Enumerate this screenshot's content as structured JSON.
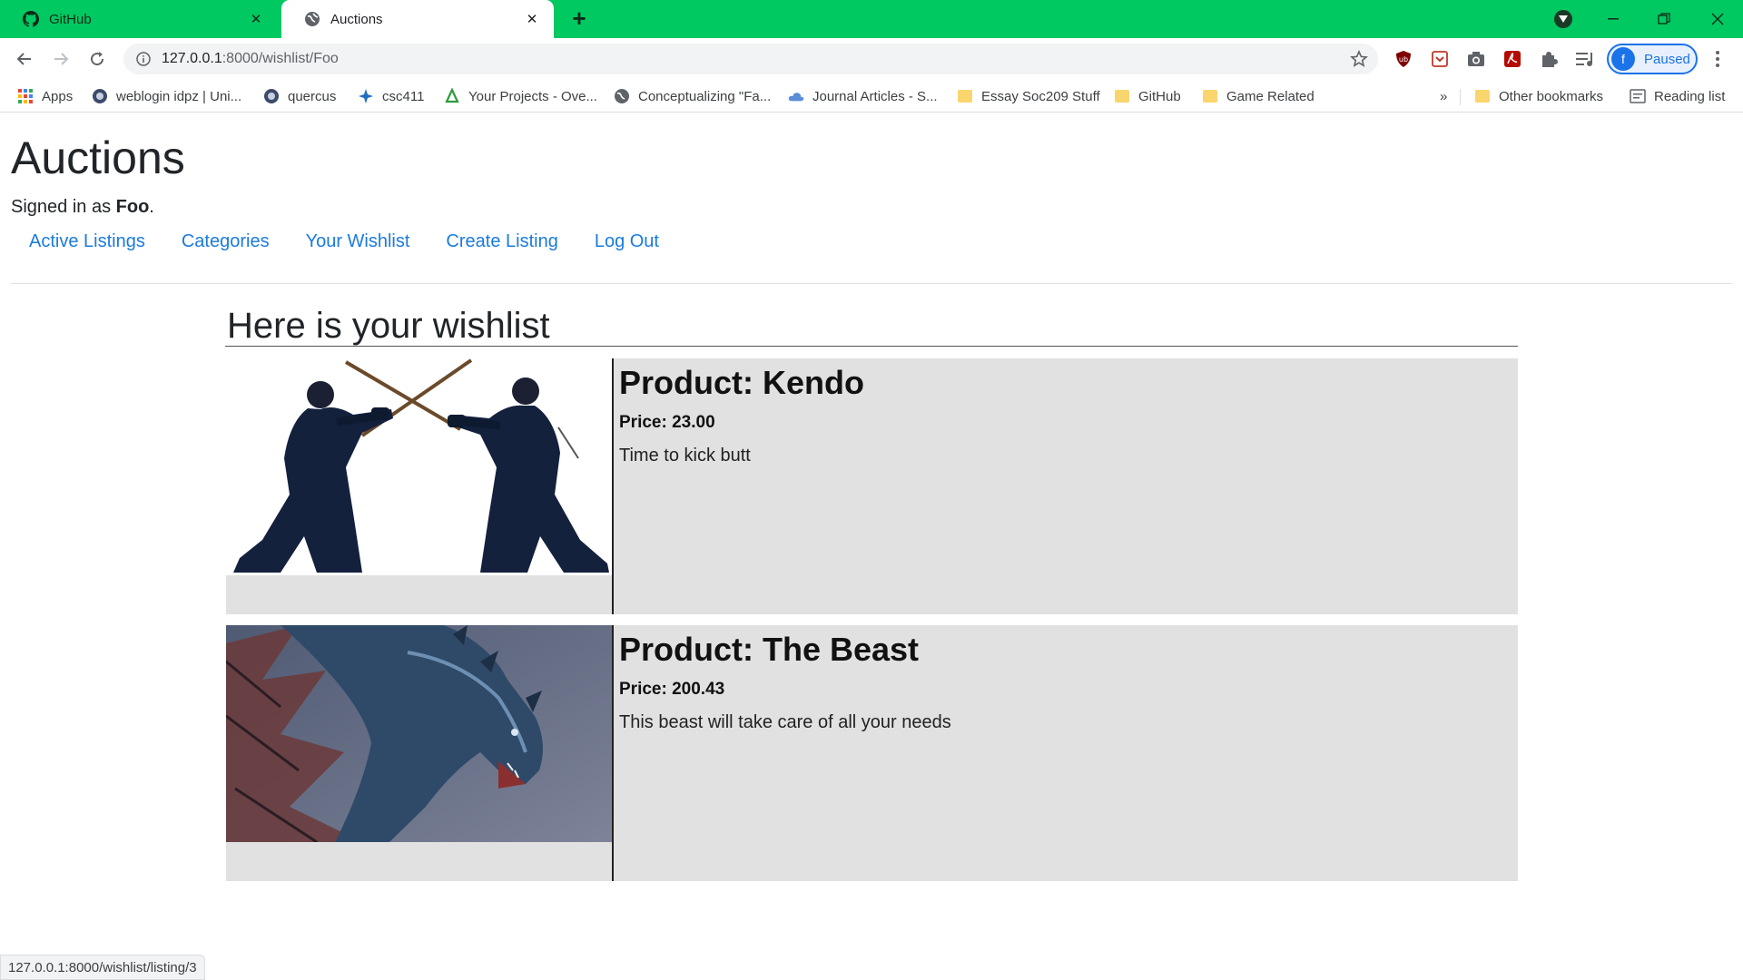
{
  "browser": {
    "tabs": [
      {
        "title": "GitHub",
        "active": false
      },
      {
        "title": "Auctions",
        "active": true
      }
    ],
    "url_host": "127.0.0.1",
    "url_rest": ":8000/wishlist/Foo",
    "profile_label": "Paused",
    "profile_initial": "f",
    "bookmarks": [
      {
        "label": "Apps",
        "icon": "apps-grid-icon"
      },
      {
        "label": "weblogin idpz | Uni...",
        "icon": "weblogin-icon"
      },
      {
        "label": "quercus",
        "icon": "quercus-icon"
      },
      {
        "label": "csc411",
        "icon": "csc411-icon"
      },
      {
        "label": "Your Projects - Ove...",
        "icon": "projects-icon"
      },
      {
        "label": "Conceptualizing \"Fa...",
        "icon": "globe-icon"
      },
      {
        "label": "Journal Articles - S...",
        "icon": "cloud-icon"
      },
      {
        "label": "Essay Soc209 Stuff",
        "icon": "folder-icon"
      },
      {
        "label": "GitHub",
        "icon": "folder-icon"
      },
      {
        "label": "Game Related",
        "icon": "folder-icon"
      }
    ],
    "bookmarks_overflow": "»",
    "other_bookmarks": "Other bookmarks",
    "reading_list": "Reading list",
    "status_url": "127.0.0.1:8000/wishlist/listing/3"
  },
  "site": {
    "title": "Auctions",
    "signed_in_prefix": "Signed in as ",
    "username": "Foo",
    "signed_in_suffix": ".",
    "nav": [
      "Active Listings",
      "Categories",
      "Your Wishlist",
      "Create Listing",
      "Log Out"
    ]
  },
  "wishlist": {
    "heading": "Here is your wishlist",
    "items": [
      {
        "title": "Product: Kendo",
        "price": "Price: 23.00",
        "description": "Time to kick butt",
        "image": "kendo-fighters-image"
      },
      {
        "title": "Product: The Beast",
        "price": "Price: 200.43",
        "description": "This beast will take care of all your needs",
        "image": "beast-dragon-image"
      }
    ]
  },
  "colors": {
    "tabstrip": "#00c962",
    "link": "#1a7be0",
    "card_bg": "#e1e1e1"
  }
}
